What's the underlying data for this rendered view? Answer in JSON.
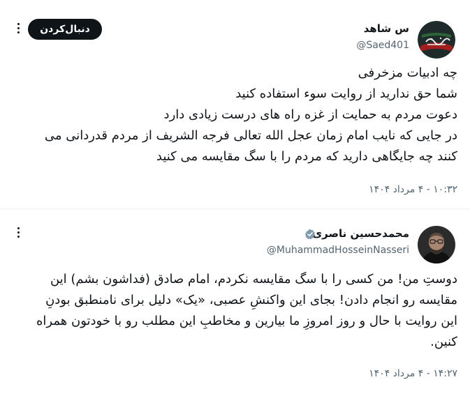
{
  "tweet1": {
    "name": "س شاهد",
    "handle": "@Saed401",
    "follow_label": "دنبال‌کردن",
    "lines": [
      "چه ادبیات مزخرفی",
      "شما حق ندارید از روایت سوء استفاده کنید",
      "دعوت مردم به حمایت از غزه راه های درست زیادی دارد",
      "در جایی که نایب امام زمان عجل الله تعالی فرجه الشریف از مردم قدردانی می",
      "کنند چه جایگاهی دارید که مردم را با سگ مقایسه می کنید"
    ],
    "timestamp": "۱۰:۳۲ - ۴ مرداد ۱۴۰۴",
    "avatar_text": "وانزلناه من السماء"
  },
  "tweet2": {
    "name": "محمدحسین ناصری",
    "handle": "@MuhammadHosseinNasseri",
    "verified": true,
    "lines": [
      "دوستِ من! من کسی را با سگ مقایسه نکردم، امام صادق (فداشون بشم) این",
      "مقایسه رو انجام دادن! بجای این واکنشِ عصبی، «یک» دلیل برای نامنطبق بودنِ",
      "این روایت با حال و روز امروزِ ما بیارین و مخاطبِ این مطلب رو با خودتون همراه",
      "کنین."
    ],
    "timestamp": "۱۴:۲۷ - ۴ مرداد ۱۴۰۴"
  },
  "colors": {
    "text": "#0f1419",
    "muted": "#536471",
    "verified": "#829aab",
    "divider": "#eff3f4"
  }
}
